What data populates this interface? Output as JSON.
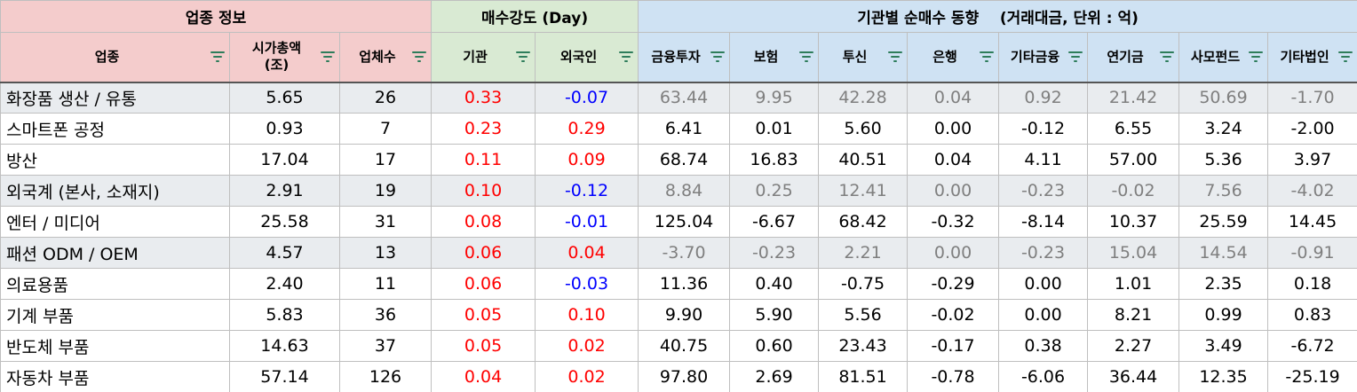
{
  "groups": {
    "info": "업종 정보",
    "strength": "매수강도 (Day)",
    "institution": "기관별 순매수 동향    (거래대금, 단위 : 억)"
  },
  "columns": {
    "sector": "업종",
    "mcap_line1": "시가총액",
    "mcap_line2": "(조)",
    "count": "업체수",
    "inst": "기관",
    "foreign": "외국인",
    "fin": "금융투자",
    "ins": "보험",
    "trust": "투신",
    "bank": "은행",
    "etcfin": "기타금융",
    "pension": "연기금",
    "pef": "사모펀드",
    "etccorp": "기타법인"
  },
  "colors": {
    "positive": "#ff0000",
    "negative": "#0000ff",
    "filter_icon": "#2e7d5b"
  },
  "rows": [
    {
      "shade": true,
      "cells": [
        "화장품 생산 / 유통",
        "5.65",
        "26",
        "0.33",
        "-0.07",
        "63.44",
        "9.95",
        "42.28",
        "0.04",
        "0.92",
        "21.42",
        "50.69",
        "-1.70"
      ]
    },
    {
      "shade": false,
      "cells": [
        "스마트폰 공정",
        "0.93",
        "7",
        "0.23",
        "0.29",
        "6.41",
        "0.01",
        "5.60",
        "0.00",
        "-0.12",
        "6.55",
        "3.24",
        "-2.00"
      ]
    },
    {
      "shade": false,
      "cells": [
        "방산",
        "17.04",
        "17",
        "0.11",
        "0.09",
        "68.74",
        "16.83",
        "40.51",
        "0.04",
        "4.11",
        "57.00",
        "5.36",
        "3.97"
      ]
    },
    {
      "shade": true,
      "cells": [
        "외국계 (본사, 소재지)",
        "2.91",
        "19",
        "0.10",
        "-0.12",
        "8.84",
        "0.25",
        "12.41",
        "0.00",
        "-0.23",
        "-0.02",
        "7.56",
        "-4.02"
      ]
    },
    {
      "shade": false,
      "cells": [
        "엔터 / 미디어",
        "25.58",
        "31",
        "0.08",
        "-0.01",
        "125.04",
        "-6.67",
        "68.42",
        "-0.32",
        "-8.14",
        "10.37",
        "25.59",
        "14.45"
      ]
    },
    {
      "shade": true,
      "cells": [
        "패션 ODM / OEM",
        "4.57",
        "13",
        "0.06",
        "0.04",
        "-3.70",
        "-0.23",
        "2.21",
        "0.00",
        "-0.23",
        "15.04",
        "14.54",
        "-0.91"
      ]
    },
    {
      "shade": false,
      "cells": [
        "의료용품",
        "2.40",
        "11",
        "0.06",
        "-0.03",
        "11.36",
        "0.40",
        "-0.75",
        "-0.29",
        "0.00",
        "1.01",
        "2.35",
        "0.18"
      ]
    },
    {
      "shade": false,
      "cells": [
        "기계 부품",
        "5.83",
        "36",
        "0.05",
        "0.10",
        "9.90",
        "5.90",
        "5.56",
        "-0.02",
        "0.00",
        "8.21",
        "0.99",
        "0.83"
      ]
    },
    {
      "shade": false,
      "cells": [
        "반도체 부품",
        "14.63",
        "37",
        "0.05",
        "0.02",
        "40.75",
        "0.60",
        "23.43",
        "-0.17",
        "0.38",
        "2.27",
        "3.49",
        "-6.72"
      ]
    },
    {
      "shade": false,
      "cells": [
        "자동차 부품",
        "57.14",
        "126",
        "0.04",
        "0.02",
        "97.80",
        "2.69",
        "81.51",
        "-0.78",
        "-6.06",
        "36.44",
        "12.35",
        "-25.19"
      ]
    }
  ]
}
